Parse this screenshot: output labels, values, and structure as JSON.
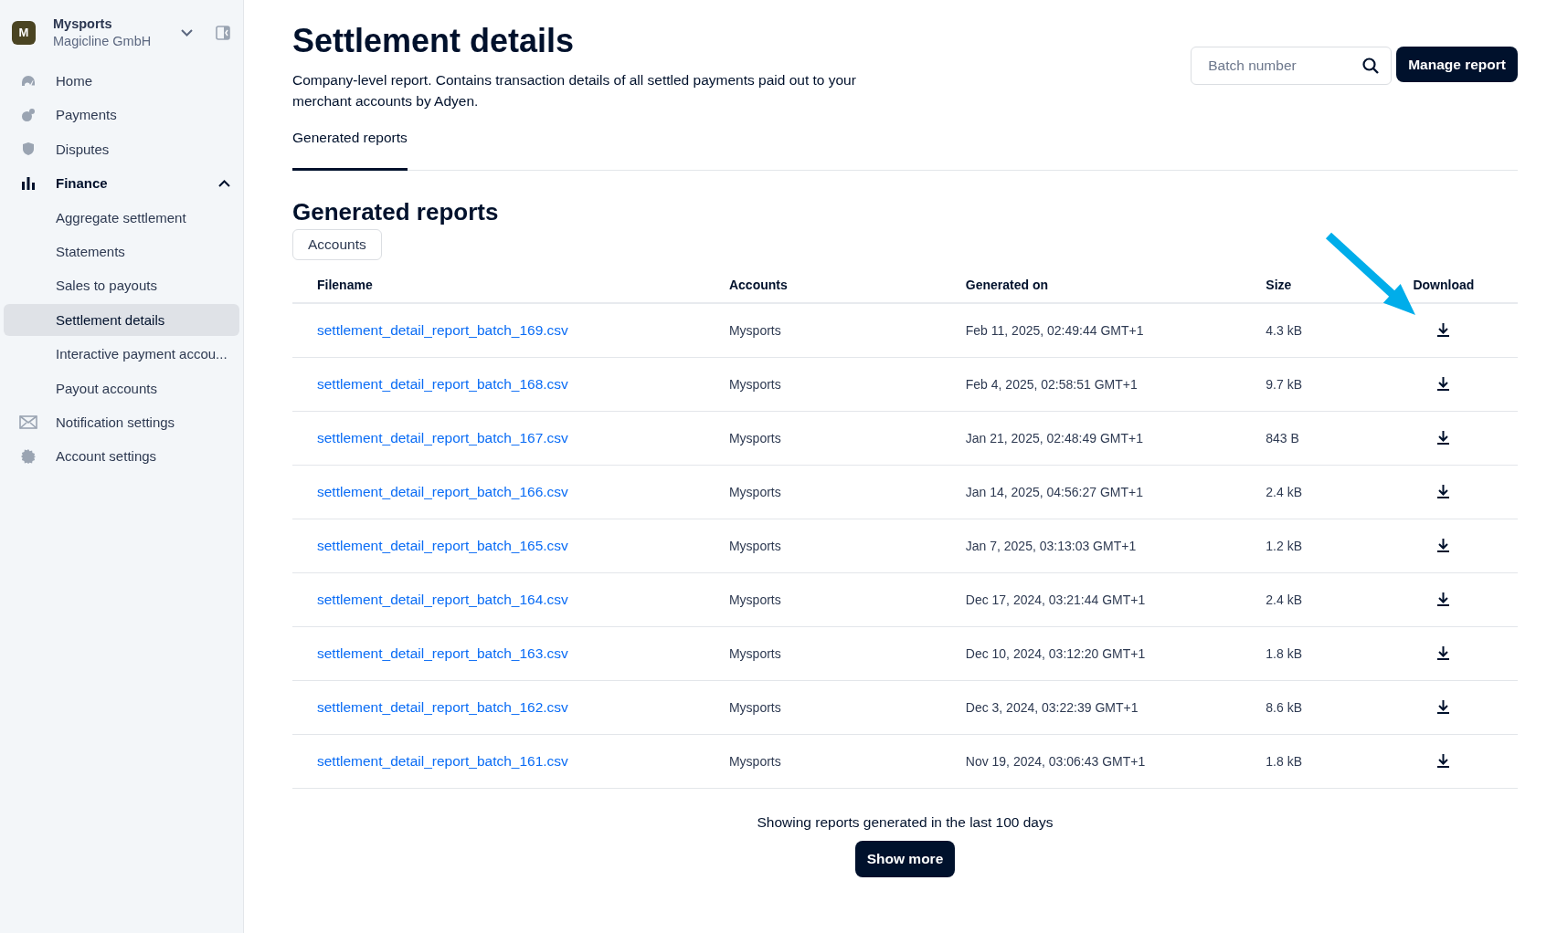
{
  "sidebar": {
    "org": {
      "initial": "M",
      "name": "Mysports",
      "company": "Magicline GmbH"
    },
    "items": [
      {
        "label": "Home",
        "selected": false
      },
      {
        "label": "Payments",
        "selected": false
      },
      {
        "label": "Disputes",
        "selected": false
      },
      {
        "label": "Finance",
        "selected": false,
        "expanded": true,
        "children": [
          {
            "label": "Aggregate settlement",
            "selected": false
          },
          {
            "label": "Statements",
            "selected": false
          },
          {
            "label": "Sales to payouts",
            "selected": false
          },
          {
            "label": "Settlement details",
            "selected": true
          },
          {
            "label": "Interactive payment accou...",
            "selected": false
          },
          {
            "label": "Payout accounts",
            "selected": false
          }
        ]
      },
      {
        "label": "Notification settings",
        "selected": false
      },
      {
        "label": "Account settings",
        "selected": false
      }
    ]
  },
  "header": {
    "title": "Settlement details",
    "description": "Company-level report. Contains transaction details of all settled payments paid out to your merchant accounts by Adyen.",
    "search": {
      "placeholder": "Batch number"
    },
    "button": "Manage report"
  },
  "tabs": [
    {
      "label": "Generated reports",
      "selected": true
    }
  ],
  "section": {
    "title": "Generated reports",
    "filters": [
      "Accounts"
    ]
  },
  "table": {
    "columns": [
      "Filename",
      "Accounts",
      "Generated on",
      "Size",
      "Download"
    ],
    "rows": [
      {
        "filename": "settlement_detail_report_batch_169.csv",
        "account": "Mysports",
        "generated": "Feb 11, 2025, 02:49:44 GMT+1",
        "size": "4.3 kB"
      },
      {
        "filename": "settlement_detail_report_batch_168.csv",
        "account": "Mysports",
        "generated": "Feb 4, 2025, 02:58:51 GMT+1",
        "size": "9.7 kB"
      },
      {
        "filename": "settlement_detail_report_batch_167.csv",
        "account": "Mysports",
        "generated": "Jan 21, 2025, 02:48:49 GMT+1",
        "size": "843 B"
      },
      {
        "filename": "settlement_detail_report_batch_166.csv",
        "account": "Mysports",
        "generated": "Jan 14, 2025, 04:56:27 GMT+1",
        "size": "2.4 kB"
      },
      {
        "filename": "settlement_detail_report_batch_165.csv",
        "account": "Mysports",
        "generated": "Jan 7, 2025, 03:13:03 GMT+1",
        "size": "1.2 kB"
      },
      {
        "filename": "settlement_detail_report_batch_164.csv",
        "account": "Mysports",
        "generated": "Dec 17, 2024, 03:21:44 GMT+1",
        "size": "2.4 kB"
      },
      {
        "filename": "settlement_detail_report_batch_163.csv",
        "account": "Mysports",
        "generated": "Dec 10, 2024, 03:12:20 GMT+1",
        "size": "1.8 kB"
      },
      {
        "filename": "settlement_detail_report_batch_162.csv",
        "account": "Mysports",
        "generated": "Dec 3, 2024, 03:22:39 GMT+1",
        "size": "8.6 kB"
      },
      {
        "filename": "settlement_detail_report_batch_161.csv",
        "account": "Mysports",
        "generated": "Nov 19, 2024, 03:06:43 GMT+1",
        "size": "1.8 kB"
      }
    ]
  },
  "footer": {
    "note": "Showing reports generated in the last 100 days",
    "button": "Show more"
  }
}
